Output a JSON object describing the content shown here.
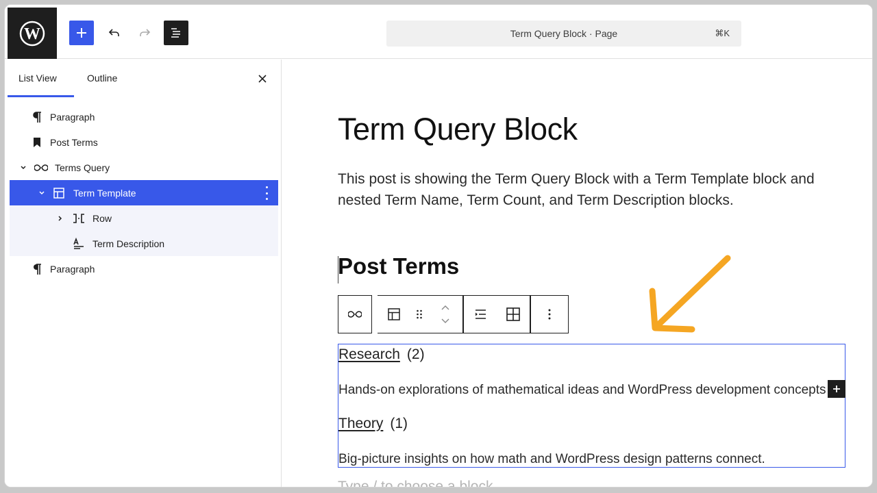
{
  "header": {
    "command_title": "Term Query Block · Page",
    "command_shortcut": "⌘K"
  },
  "sidebar": {
    "tabs": [
      {
        "label": "List View",
        "active": true
      },
      {
        "label": "Outline",
        "active": false
      }
    ],
    "items": [
      {
        "label": "Paragraph",
        "icon": "paragraph-icon"
      },
      {
        "label": "Post Terms",
        "icon": "bookmark-icon"
      },
      {
        "label": "Terms Query",
        "icon": "loop-icon",
        "expanded": true
      },
      {
        "label": "Term Template",
        "icon": "layout-icon",
        "expanded": true,
        "selected": true
      },
      {
        "label": "Row",
        "icon": "row-icon",
        "expanded": false
      },
      {
        "label": "Term Description",
        "icon": "text-description-icon"
      },
      {
        "label": "Paragraph",
        "icon": "paragraph-icon"
      }
    ]
  },
  "content": {
    "title": "Term Query Block",
    "intro": "This post is showing the Term Query Block with a Term Template block and nested Term Name, Term Count, and Term Description blocks.",
    "subheading": "Post Terms",
    "terms": [
      {
        "name": "Research",
        "count": "(2)",
        "description": "Hands-on explorations of mathematical ideas and WordPress development concepts."
      },
      {
        "name": "Theory",
        "count": "(1)",
        "description": "Big-picture insights on how math and WordPress design patterns connect."
      }
    ],
    "placeholder": "Type / to choose a block"
  },
  "colors": {
    "accent": "#3858e9",
    "annotation_arrow": "#f5a623"
  }
}
